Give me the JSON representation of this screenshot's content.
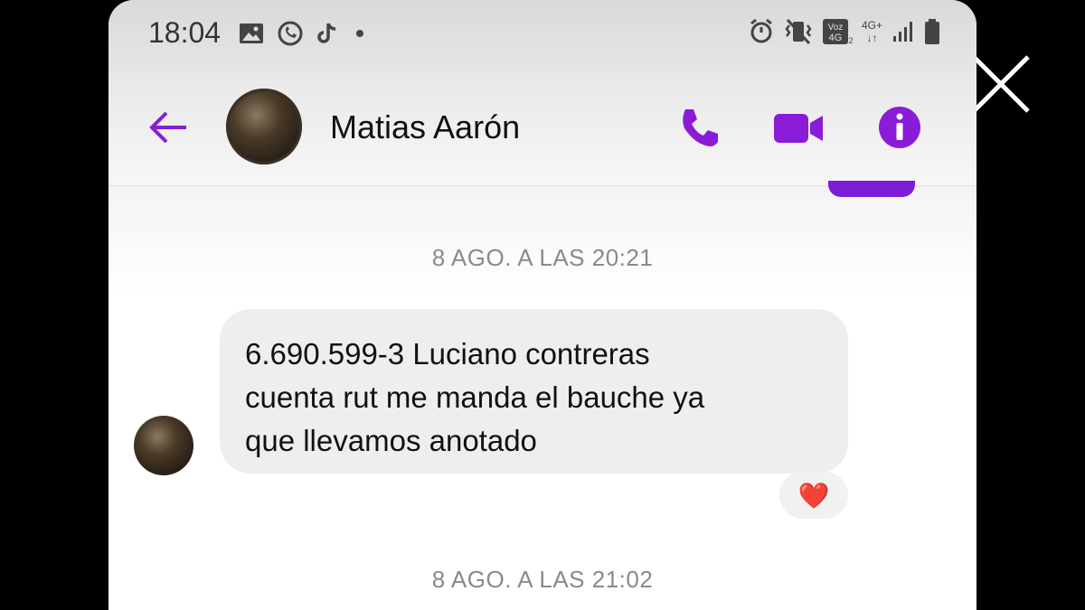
{
  "status_bar": {
    "time": "18:04",
    "left_icons": [
      "gallery-icon",
      "whatsapp-icon",
      "tiktok-icon",
      "dot-icon"
    ],
    "right_icons": [
      "alarm-icon",
      "vibrate-icon",
      "volte-icon",
      "signal-icon",
      "battery-icon"
    ],
    "volte_label": "Voz 4G",
    "network_label": "4G+"
  },
  "header": {
    "contact_name": "Matias Aarón",
    "accent_color": "#8a1cd8"
  },
  "messages": [
    {
      "timestamp": "8 AGO. A LAS 20:21"
    },
    {
      "text": "6.690.599-3 Luciano contreras\ncuenta rut me manda el bauche ya\nque llevamos anotado",
      "reaction": "❤️"
    },
    {
      "timestamp": "8 AGO. A LAS 21:02"
    }
  ]
}
